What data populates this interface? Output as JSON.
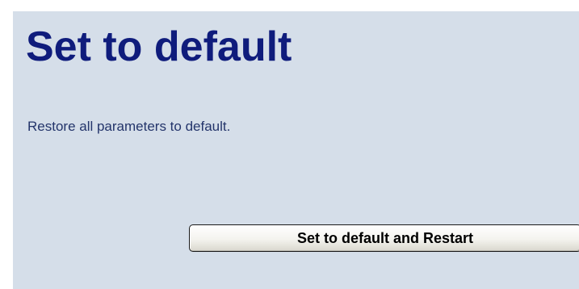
{
  "page": {
    "title": "Set to default",
    "description": "Restore all parameters to default.",
    "button_label": "Set to default and Restart"
  },
  "colors": {
    "panel_background": "#d5dee9",
    "title": "#0f1c7c",
    "description": "#24356b"
  }
}
